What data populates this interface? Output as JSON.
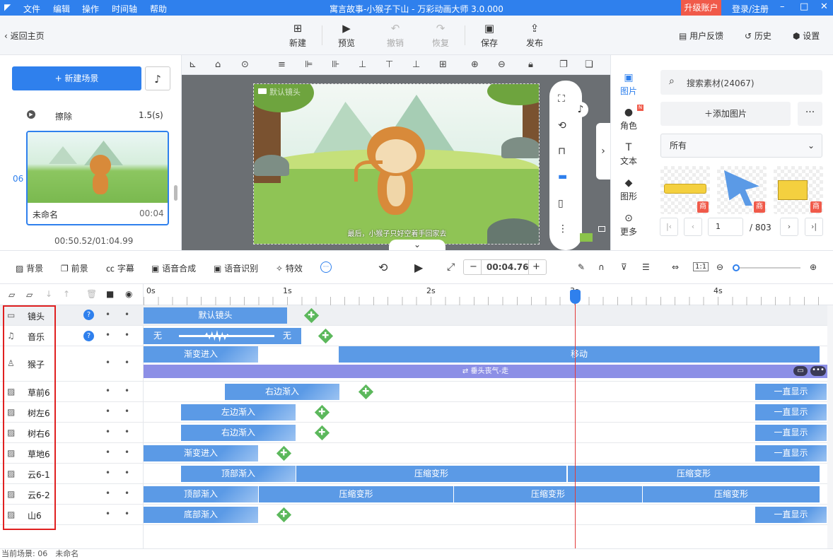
{
  "window": {
    "title": "寓言故事-小猴子下山 - 万彩动画大师 3.0.000",
    "upgrade": "升级账户",
    "login": "登录/注册",
    "minimize": "–",
    "maximize": "□",
    "close": "✕"
  },
  "menu": [
    "文件",
    "编辑",
    "操作",
    "时间轴",
    "帮助"
  ],
  "toolbar": {
    "back": "返回主页",
    "new": "新建",
    "preview": "预览",
    "undo": "撤销",
    "redo": "恢复",
    "save": "保存",
    "publish": "发布",
    "feedback": "用户反馈",
    "history": "历史",
    "settings": "设置"
  },
  "scenes": {
    "new_scene": "+ 新建场景",
    "transition_name": "擦除",
    "transition_duration": "1.5(s)",
    "scene_number": "06",
    "scene_name": "未命名",
    "scene_duration": "00:04",
    "time_progress": "00:50.52/01:04.99"
  },
  "stage": {
    "caption": "最后，小猴子只好空着手回家去",
    "camera_label": "默认镜头"
  },
  "resource_nav": [
    "图片",
    "角色",
    "文本",
    "图形",
    "更多"
  ],
  "resources": {
    "search_placeholder": "搜索素材(24067)",
    "add_image": "添加图片",
    "more": "···",
    "category": "所有",
    "shang": "商",
    "page": "1",
    "page_total": "/ 803"
  },
  "bottom_tools": {
    "background": "背景",
    "foreground": "前景",
    "subtitle": "字幕",
    "tts": "语音合成",
    "asr": "语音识别",
    "effects": "特效",
    "time": "00:04.76",
    "minus": "−",
    "plus": "+"
  },
  "ruler": [
    "0s",
    "1s",
    "2s",
    "3s",
    "4s"
  ],
  "tracks": [
    {
      "name": "镜头",
      "icon": "camera-icon"
    },
    {
      "name": "音乐",
      "icon": "music-icon"
    },
    {
      "name": "猴子",
      "icon": "character-icon"
    },
    {
      "name": "草前6",
      "icon": "image-icon"
    },
    {
      "name": "树左6",
      "icon": "image-icon"
    },
    {
      "name": "树右6",
      "icon": "image-icon"
    },
    {
      "name": "草地6",
      "icon": "image-icon"
    },
    {
      "name": "云6-1",
      "icon": "image-icon"
    },
    {
      "name": "云6-2",
      "icon": "image-icon"
    },
    {
      "name": "山6",
      "icon": "image-icon"
    }
  ],
  "clips": {
    "camera": "默认镜头",
    "music_start": "无",
    "music_end": "无",
    "monkey_in": "渐变进入",
    "monkey_move": "移动",
    "monkey_action": "垂头丧气-走",
    "grass_front": "右边渐入",
    "tree_left": "左边渐入",
    "tree_right": "右边渐入",
    "grass": "渐变进入",
    "cloud1_in": "顶部渐入",
    "cloud2_in": "顶部渐入",
    "squeeze": "压缩变形",
    "mountain": "底部渐入",
    "always": "一直显示"
  },
  "status": {
    "current_scene": "当前场景: 06　未命名"
  },
  "colors": {
    "accent": "#2f80ed",
    "clip": "#5b9ae6",
    "playhead": "#e23a3a",
    "highlight_box": "#e02020",
    "upgrade": "#f05a4a"
  }
}
